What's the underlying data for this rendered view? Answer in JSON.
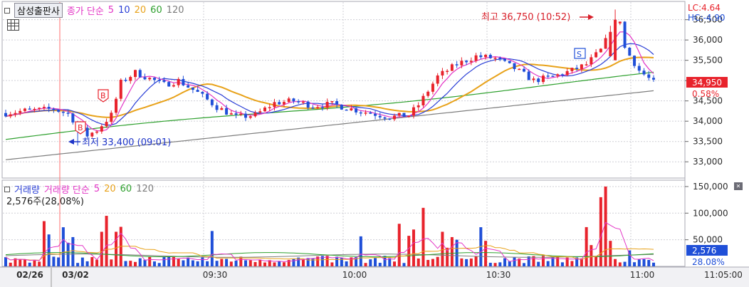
{
  "toolbar": {
    "stock_name": "삼성출판사"
  },
  "price_legend": {
    "label": "종가 단순",
    "periods": [
      "5",
      "10",
      "20",
      "60",
      "120"
    ]
  },
  "volume_legend": {
    "label": "거래량 단순",
    "periods": [
      "5",
      "20",
      "60",
      "120"
    ],
    "current_text": "2,576주(28,08%)"
  },
  "corner_readout": {
    "lc": "LC:4.64",
    "hc": "HC:-4.90"
  },
  "annotations": {
    "high": "최고 36,750 (10:52)",
    "low": "최저 33,400 (09:01)",
    "buy_marker": "B",
    "sell_marker": "S"
  },
  "current_price_tag": {
    "price": "34,950",
    "change": "0.58%"
  },
  "current_volume_tag": {
    "volume": "2,576",
    "ratio": "28.08%"
  },
  "colors": {
    "up": "#e8232c",
    "down": "#1f4fd8",
    "ma5": "#e335c6",
    "ma10": "#2b3fd6",
    "ma20": "#e8a21a",
    "ma60": "#2ea02e",
    "ma120": "#7d7d7d",
    "grid": "#cfcfd6",
    "axis_text": "#2b2b2b",
    "price_tag_bg": "#e8232c",
    "volume_tag_bg": "#1f4fd8",
    "low_annotation": "#1e35c8",
    "high_annotation": "#d8202a"
  },
  "chart_data": [
    {
      "type": "candlestick",
      "title": "종가 단순 5 10 20 60 120",
      "x_labels": [
        "02/26",
        "03/02",
        "09:30",
        "10:00",
        "10:30",
        "11:00"
      ],
      "y_ticks": [
        "36,500",
        "36,000",
        "35,500",
        "35,000",
        "34,500",
        "34,000",
        "33,500",
        "33,000"
      ],
      "y_range": [
        32600,
        36950
      ],
      "high": 36750,
      "low": 33400,
      "last": 34950,
      "last_change_pct": 0.58,
      "legend": [
        "종가 단순 5",
        "10",
        "20",
        "60",
        "120"
      ],
      "grid": true
    },
    {
      "type": "bar",
      "title": "거래량 단순 5 20 60 120",
      "y_ticks": [
        "150,000",
        "100,000",
        "50,000"
      ],
      "y_range": [
        0,
        162000
      ],
      "last_volume": 2576,
      "last_ratio_pct": 28.08,
      "grid": true
    }
  ],
  "time_axis": {
    "labels": [
      "02/26",
      "03/02",
      "09:30",
      "10:00",
      "10:30",
      "11:00",
      "11:05:00"
    ]
  }
}
